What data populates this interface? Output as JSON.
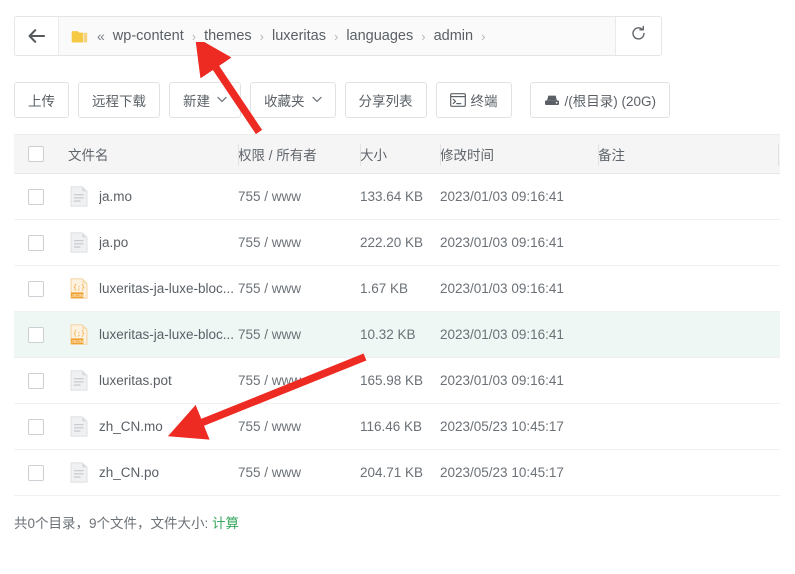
{
  "breadcrumb": {
    "back_icon": "arrow-left-icon",
    "folder_icon": "folder-icon",
    "overflow": "«",
    "separator": "›",
    "items": [
      {
        "label": "wp-content"
      },
      {
        "label": "themes"
      },
      {
        "label": "luxeritas"
      },
      {
        "label": "languages"
      },
      {
        "label": "admin"
      }
    ],
    "refresh_icon": "refresh-icon"
  },
  "toolbar": {
    "buttons": [
      {
        "label": "上传",
        "icon": "",
        "dropdown": false
      },
      {
        "label": "远程下载",
        "icon": "",
        "dropdown": false
      },
      {
        "label": "新建",
        "icon": "",
        "dropdown": true
      },
      {
        "label": "收藏夹",
        "icon": "",
        "dropdown": true
      },
      {
        "label": "分享列表",
        "icon": "",
        "dropdown": false
      },
      {
        "label": "终端",
        "icon": "terminal-icon",
        "dropdown": false
      }
    ],
    "disk_button": {
      "label": "/(根目录) (20G)",
      "icon": "disk-icon"
    },
    "chevron": "⌄"
  },
  "table": {
    "headers": {
      "name": "文件名",
      "perm": "权限 / 所有者",
      "size": "大小",
      "time": "修改时间",
      "note": "备注"
    },
    "rows": [
      {
        "name": "ja.mo",
        "icon": "file-doc-icon",
        "perm": "755 / www",
        "size": "133.64 KB",
        "time": "2023/01/03 09:16:41",
        "note": "",
        "selected": false
      },
      {
        "name": "ja.po",
        "icon": "file-doc-icon",
        "perm": "755 / www",
        "size": "222.20 KB",
        "time": "2023/01/03 09:16:41",
        "note": "",
        "selected": false
      },
      {
        "name": "luxeritas-ja-luxe-bloc...",
        "icon": "file-json-icon",
        "perm": "755 / www",
        "size": "1.67 KB",
        "time": "2023/01/03 09:16:41",
        "note": "",
        "selected": false
      },
      {
        "name": "luxeritas-ja-luxe-bloc...",
        "icon": "file-json-icon",
        "perm": "755 / www",
        "size": "10.32 KB",
        "time": "2023/01/03 09:16:41",
        "note": "",
        "selected": true
      },
      {
        "name": "luxeritas.pot",
        "icon": "file-doc-icon",
        "perm": "755 / www",
        "size": "165.98 KB",
        "time": "2023/01/03 09:16:41",
        "note": "",
        "selected": false
      },
      {
        "name": "zh_CN.mo",
        "icon": "file-doc-icon",
        "perm": "755 / www",
        "size": "116.46 KB",
        "time": "2023/05/23 10:45:17",
        "note": "",
        "selected": false
      },
      {
        "name": "zh_CN.po",
        "icon": "file-doc-icon",
        "perm": "755 / www",
        "size": "204.71 KB",
        "time": "2023/05/23 10:45:17",
        "note": "",
        "selected": false
      }
    ]
  },
  "footer": {
    "summary": "共0个目录，9个文件，文件大小:",
    "calc_label": "计算"
  },
  "annotations": {
    "color": "#ee2b22",
    "arrows": [
      {
        "name": "arrow-pointing-to-themes"
      },
      {
        "name": "arrow-pointing-to-zh-cn-mo"
      }
    ]
  },
  "colors": {
    "selected_row": "#eef7f4",
    "header_bg": "#f5f5f5",
    "link_green": "#3aa861",
    "folder_yellow": "#f5c74c",
    "json_orange": "#f0a12e",
    "annotation_red": "#ee2b22"
  }
}
